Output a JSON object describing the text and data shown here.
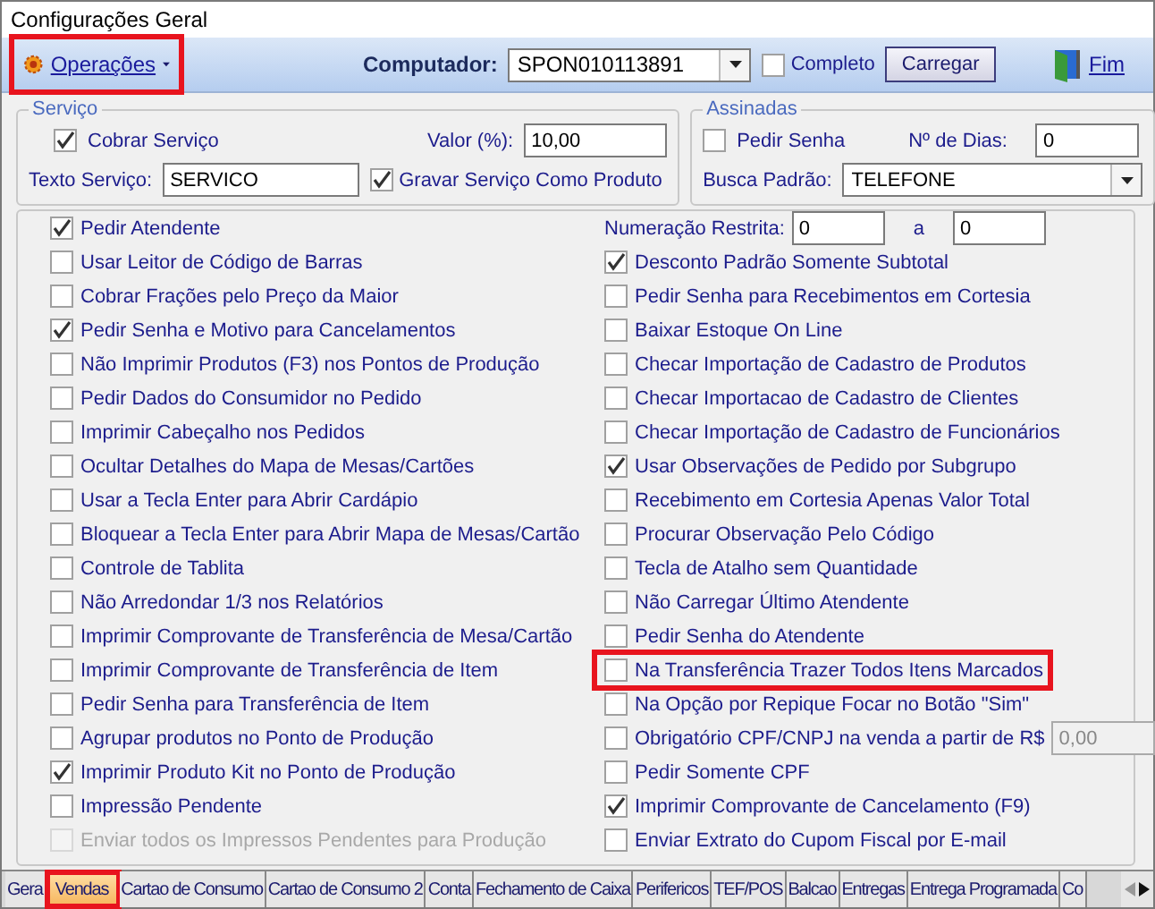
{
  "window": {
    "title": "Configurações Geral"
  },
  "toolbar": {
    "operations": {
      "label": "Operações",
      "highlighted": true
    },
    "computer_label": "Computador:",
    "computer_value": "SPON010113891",
    "completo": {
      "label": "Completo",
      "checked": false
    },
    "load_button": "Carregar",
    "exit_button": "Fim"
  },
  "servico": {
    "title": "Serviço",
    "cobrar": {
      "label": "Cobrar Serviço",
      "checked": true
    },
    "valor_label": "Valor (%):",
    "valor": "10,00",
    "texto_label": "Texto Serviço:",
    "texto": "SERVICO",
    "gravar": {
      "label": "Gravar Serviço Como Produto",
      "checked": true
    }
  },
  "assinadas": {
    "title": "Assinadas",
    "pedir_senha": {
      "label": "Pedir Senha",
      "checked": false
    },
    "dias_label": "Nº de Dias:",
    "dias": "0",
    "busca_label": "Busca Padrão:",
    "busca": "TELEFONE"
  },
  "left_options": [
    {
      "label": "Pedir Atendente",
      "checked": true,
      "disabled": false
    },
    {
      "label": "Usar Leitor de Código de Barras",
      "checked": false,
      "disabled": false
    },
    {
      "label": "Cobrar Frações pelo Preço da Maior",
      "checked": false,
      "disabled": false
    },
    {
      "label": "Pedir Senha e Motivo para Cancelamentos",
      "checked": true,
      "disabled": false
    },
    {
      "label": "Não Imprimir Produtos (F3) nos Pontos de Produção",
      "checked": false,
      "disabled": false
    },
    {
      "label": "Pedir Dados do Consumidor no Pedido",
      "checked": false,
      "disabled": false
    },
    {
      "label": "Imprimir Cabeçalho nos Pedidos",
      "checked": false,
      "disabled": false
    },
    {
      "label": "Ocultar Detalhes do Mapa de Mesas/Cartões",
      "checked": false,
      "disabled": false
    },
    {
      "label": "Usar a Tecla Enter para Abrir Cardápio",
      "checked": false,
      "disabled": false
    },
    {
      "label": "Bloquear a Tecla Enter para Abrir Mapa de Mesas/Cartão",
      "checked": false,
      "disabled": false
    },
    {
      "label": "Controle de Tablita",
      "checked": false,
      "disabled": false
    },
    {
      "label": "Não Arredondar 1/3 nos Relatórios",
      "checked": false,
      "disabled": false
    },
    {
      "label": "Imprimir Comprovante de Transferência de Mesa/Cartão",
      "checked": false,
      "disabled": false
    },
    {
      "label": "Imprimir Comprovante de Transferência de Item",
      "checked": false,
      "disabled": false
    },
    {
      "label": "Pedir Senha para Transferência de Item",
      "checked": false,
      "disabled": false
    },
    {
      "label": "Agrupar produtos no Ponto de Produção",
      "checked": false,
      "disabled": false
    },
    {
      "label": "Imprimir Produto Kit no Ponto de Produção",
      "checked": true,
      "disabled": false
    },
    {
      "label": "Impressão Pendente",
      "checked": false,
      "disabled": false
    },
    {
      "label": "Enviar todos os Impressos Pendentes para Produção",
      "checked": false,
      "disabled": true
    }
  ],
  "numeracao": {
    "label": "Numeração Restrita:",
    "from": "0",
    "separator": "a",
    "to": "0"
  },
  "right_options": [
    {
      "kind": "checkbox",
      "label": "Desconto Padrão Somente Subtotal",
      "checked": true,
      "highlighted": false
    },
    {
      "kind": "checkbox",
      "label": "Pedir Senha para Recebimentos em Cortesia",
      "checked": false,
      "highlighted": false
    },
    {
      "kind": "checkbox",
      "label": "Baixar Estoque On Line",
      "checked": false,
      "highlighted": false
    },
    {
      "kind": "checkbox",
      "label": "Checar Importação de Cadastro de Produtos",
      "checked": false,
      "highlighted": false
    },
    {
      "kind": "checkbox",
      "label": "Checar Importacao de Cadastro de Clientes",
      "checked": false,
      "highlighted": false
    },
    {
      "kind": "checkbox",
      "label": "Checar Importação de Cadastro de Funcionários",
      "checked": false,
      "highlighted": false
    },
    {
      "kind": "checkbox",
      "label": "Usar Observações de Pedido por Subgrupo",
      "checked": true,
      "highlighted": false
    },
    {
      "kind": "checkbox",
      "label": "Recebimento em Cortesia Apenas Valor Total",
      "checked": false,
      "highlighted": false
    },
    {
      "kind": "checkbox",
      "label": "Procurar Observação Pelo Código",
      "checked": false,
      "highlighted": false
    },
    {
      "kind": "checkbox",
      "label": "Tecla de Atalho sem Quantidade",
      "checked": false,
      "highlighted": false
    },
    {
      "kind": "checkbox",
      "label": "Não Carregar Último Atendente",
      "checked": false,
      "highlighted": false
    },
    {
      "kind": "checkbox",
      "label": "Pedir Senha do Atendente",
      "checked": false,
      "highlighted": false
    },
    {
      "kind": "checkbox",
      "label": "Na Transferência Trazer Todos Itens Marcados",
      "checked": false,
      "highlighted": true
    },
    {
      "kind": "checkbox",
      "label": "Na Opção por Repique Focar no Botão \"Sim\"",
      "checked": false,
      "highlighted": false
    },
    {
      "kind": "checkbox-field",
      "label": "Obrigatório CPF/CNPJ na venda a partir de R$",
      "checked": false,
      "highlighted": false,
      "value": "0,00"
    },
    {
      "kind": "checkbox",
      "label": "Pedir Somente CPF",
      "checked": false,
      "highlighted": false
    },
    {
      "kind": "checkbox",
      "label": "Imprimir Comprovante de Cancelamento (F9)",
      "checked": true,
      "highlighted": false
    },
    {
      "kind": "checkbox",
      "label": "Enviar Extrato do Cupom Fiscal por E-mail",
      "checked": false,
      "highlighted": false
    }
  ],
  "tabs": [
    {
      "label": "Gera",
      "selected": false,
      "highlighted": false
    },
    {
      "label": "Vendas",
      "selected": true,
      "highlighted": true
    },
    {
      "label": "Cartao de Consumo",
      "selected": false,
      "highlighted": false
    },
    {
      "label": "Cartao de Consumo 2",
      "selected": false,
      "highlighted": false
    },
    {
      "label": "Conta",
      "selected": false,
      "highlighted": false
    },
    {
      "label": "Fechamento de Caixa",
      "selected": false,
      "highlighted": false
    },
    {
      "label": "Perifericos",
      "selected": false,
      "highlighted": false
    },
    {
      "label": "TEF/POS",
      "selected": false,
      "highlighted": false
    },
    {
      "label": "Balcao",
      "selected": false,
      "highlighted": false
    },
    {
      "label": "Entregas",
      "selected": false,
      "highlighted": false
    },
    {
      "label": "Entrega Programada",
      "selected": false,
      "highlighted": false
    },
    {
      "label": "Co",
      "selected": false,
      "highlighted": false
    }
  ]
}
